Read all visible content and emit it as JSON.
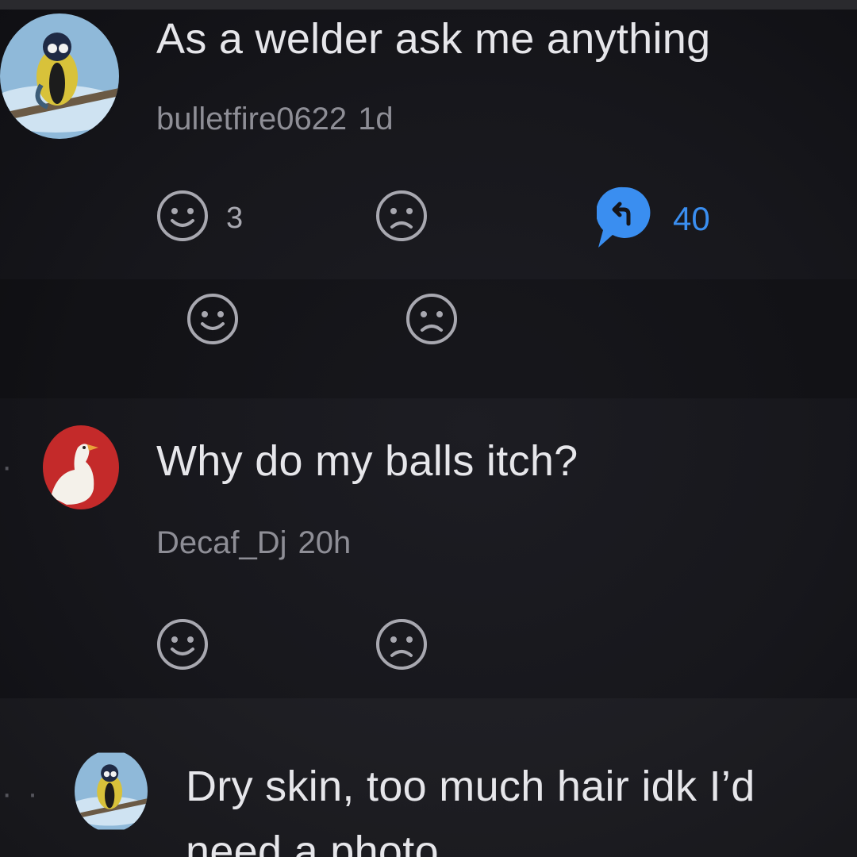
{
  "post": {
    "title": "As a welder ask me anything",
    "author": "bulletfire0622",
    "time": "1d",
    "like_count": "3",
    "reply_count": "40"
  },
  "comment": {
    "text": "Why do my balls itch?",
    "author": "Decaf_Dj",
    "time": "20h"
  },
  "reply": {
    "text_line1": "Dry skin, too much hair idk I’d",
    "text_line2": "need a photo"
  },
  "colors": {
    "accent_blue": "#3a8ef0",
    "text_primary": "#e6e6ea",
    "text_secondary": "#8e8e96"
  },
  "icons": [
    "smile-icon",
    "frown-icon",
    "reply-bubble-icon"
  ]
}
